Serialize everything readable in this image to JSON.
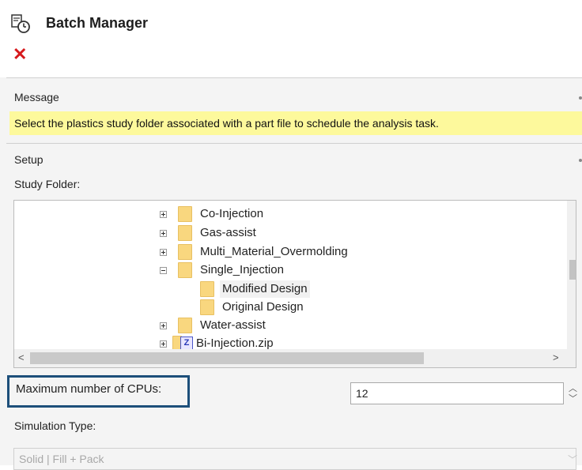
{
  "header": {
    "title": "Batch Manager",
    "icon": "batch-manager-icon",
    "close_icon": "close-icon"
  },
  "message": {
    "label": "Message",
    "text": "Select the plastics study folder associated with a part file to schedule the analysis task.",
    "highlight_color": "#fdf99c"
  },
  "setup": {
    "label": "Setup",
    "study_folder_label": "Study Folder:",
    "tree": [
      {
        "label": "Co-Injection",
        "expander": "plus",
        "icon": "folder-icon"
      },
      {
        "label": "Gas-assist",
        "expander": "plus",
        "icon": "folder-icon"
      },
      {
        "label": "Multi_Material_Overmolding",
        "expander": "plus",
        "icon": "folder-icon"
      },
      {
        "label": "Single_Injection",
        "expander": "minus",
        "icon": "folder-icon"
      },
      {
        "label": "Modified Design",
        "expander": "none",
        "icon": "folder-icon",
        "selected": true
      },
      {
        "label": "Original Design",
        "expander": "none",
        "icon": "folder-icon"
      },
      {
        "label": "Water-assist",
        "expander": "plus",
        "icon": "folder-icon"
      },
      {
        "label": "Bi-Injection.zip",
        "expander": "plus",
        "icon": "zip-file-icon",
        "zip_letter": "Z"
      }
    ],
    "scroll_arrows": {
      "up": "⌃",
      "down": "⌄",
      "left": "<",
      "right": ">"
    }
  },
  "cpus": {
    "label": "Maximum number of CPUs:",
    "value": "12",
    "highlight_color": "#1d4f7a"
  },
  "simulation": {
    "label": "Simulation Type:",
    "value": "Solid | Fill + Pack"
  },
  "colors": {
    "close_red": "#d6191c",
    "folder_yellow": "#f9d77f"
  }
}
